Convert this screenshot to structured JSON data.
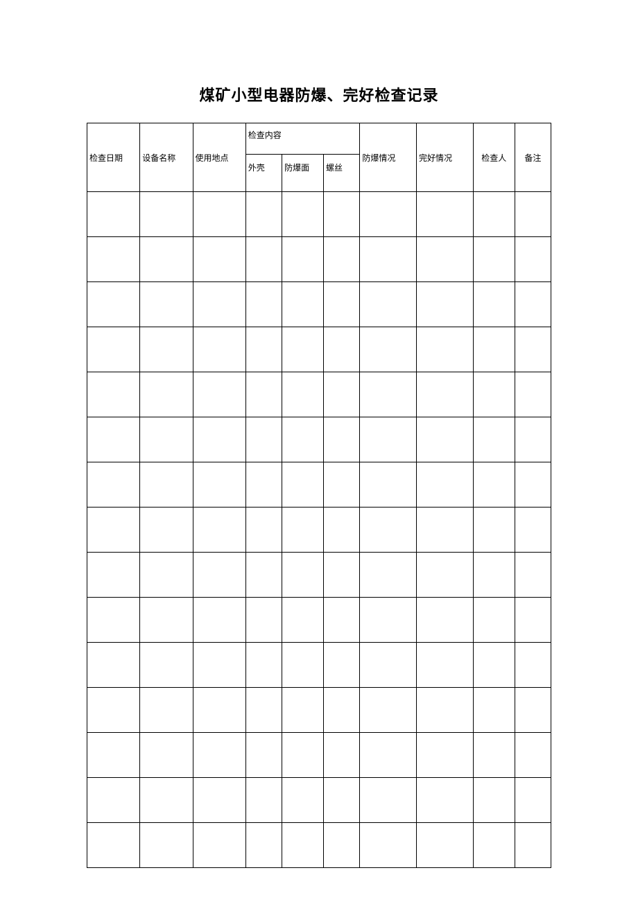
{
  "title": "煤矿小型电器防爆、完好检查记录",
  "headers": {
    "date": "检查日期",
    "equipment_name": "设备名称",
    "location": "使用地点",
    "inspection_content": "检查内容",
    "shell": "外壳",
    "explosion_face": "防爆面",
    "screw": "螺丝",
    "explosion_status": "防爆情况",
    "good_status": "完好情况",
    "inspector": "检查人",
    "remark": "备注"
  },
  "rows": [
    {
      "date": "",
      "equipment_name": "",
      "location": "",
      "shell": "",
      "explosion_face": "",
      "screw": "",
      "explosion_status": "",
      "good_status": "",
      "inspector": "",
      "remark": ""
    },
    {
      "date": "",
      "equipment_name": "",
      "location": "",
      "shell": "",
      "explosion_face": "",
      "screw": "",
      "explosion_status": "",
      "good_status": "",
      "inspector": "",
      "remark": ""
    },
    {
      "date": "",
      "equipment_name": "",
      "location": "",
      "shell": "",
      "explosion_face": "",
      "screw": "",
      "explosion_status": "",
      "good_status": "",
      "inspector": "",
      "remark": ""
    },
    {
      "date": "",
      "equipment_name": "",
      "location": "",
      "shell": "",
      "explosion_face": "",
      "screw": "",
      "explosion_status": "",
      "good_status": "",
      "inspector": "",
      "remark": ""
    },
    {
      "date": "",
      "equipment_name": "",
      "location": "",
      "shell": "",
      "explosion_face": "",
      "screw": "",
      "explosion_status": "",
      "good_status": "",
      "inspector": "",
      "remark": ""
    },
    {
      "date": "",
      "equipment_name": "",
      "location": "",
      "shell": "",
      "explosion_face": "",
      "screw": "",
      "explosion_status": "",
      "good_status": "",
      "inspector": "",
      "remark": ""
    },
    {
      "date": "",
      "equipment_name": "",
      "location": "",
      "shell": "",
      "explosion_face": "",
      "screw": "",
      "explosion_status": "",
      "good_status": "",
      "inspector": "",
      "remark": ""
    },
    {
      "date": "",
      "equipment_name": "",
      "location": "",
      "shell": "",
      "explosion_face": "",
      "screw": "",
      "explosion_status": "",
      "good_status": "",
      "inspector": "",
      "remark": ""
    },
    {
      "date": "",
      "equipment_name": "",
      "location": "",
      "shell": "",
      "explosion_face": "",
      "screw": "",
      "explosion_status": "",
      "good_status": "",
      "inspector": "",
      "remark": ""
    },
    {
      "date": "",
      "equipment_name": "",
      "location": "",
      "shell": "",
      "explosion_face": "",
      "screw": "",
      "explosion_status": "",
      "good_status": "",
      "inspector": "",
      "remark": ""
    },
    {
      "date": "",
      "equipment_name": "",
      "location": "",
      "shell": "",
      "explosion_face": "",
      "screw": "",
      "explosion_status": "",
      "good_status": "",
      "inspector": "",
      "remark": ""
    },
    {
      "date": "",
      "equipment_name": "",
      "location": "",
      "shell": "",
      "explosion_face": "",
      "screw": "",
      "explosion_status": "",
      "good_status": "",
      "inspector": "",
      "remark": ""
    },
    {
      "date": "",
      "equipment_name": "",
      "location": "",
      "shell": "",
      "explosion_face": "",
      "screw": "",
      "explosion_status": "",
      "good_status": "",
      "inspector": "",
      "remark": ""
    },
    {
      "date": "",
      "equipment_name": "",
      "location": "",
      "shell": "",
      "explosion_face": "",
      "screw": "",
      "explosion_status": "",
      "good_status": "",
      "inspector": "",
      "remark": ""
    },
    {
      "date": "",
      "equipment_name": "",
      "location": "",
      "shell": "",
      "explosion_face": "",
      "screw": "",
      "explosion_status": "",
      "good_status": "",
      "inspector": "",
      "remark": ""
    }
  ]
}
